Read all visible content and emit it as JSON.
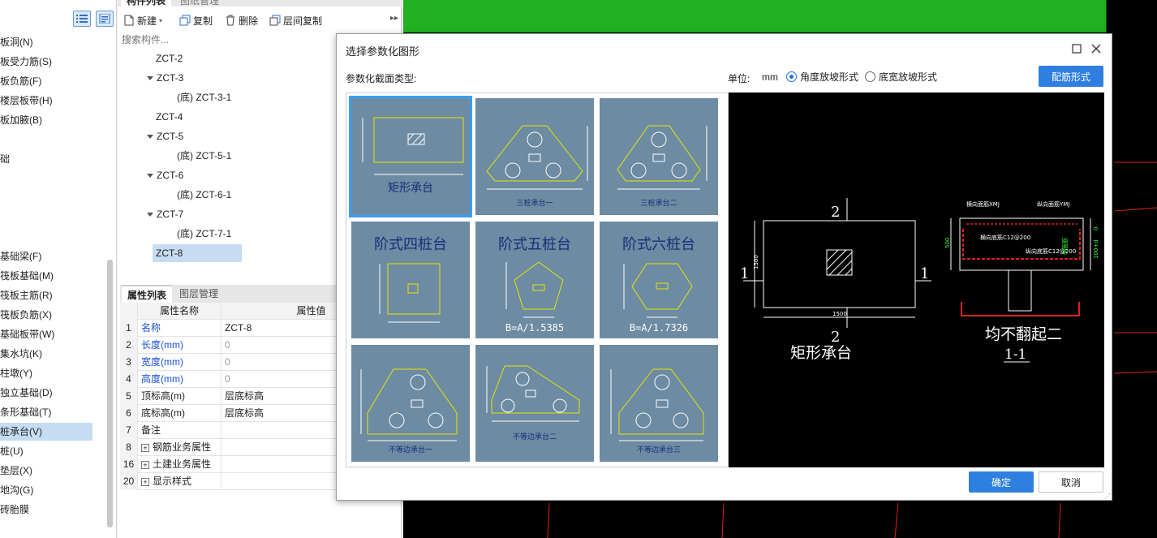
{
  "left_tree": {
    "items": [
      {
        "label": "板洞(N)"
      },
      {
        "label": "板受力筋(S)"
      },
      {
        "label": "板负筋(F)"
      },
      {
        "label": "楼层板带(H)"
      },
      {
        "label": "板加腋(B)"
      },
      {
        "label": "础"
      },
      {
        "label": "基础梁(F)"
      },
      {
        "label": "筏板基础(M)"
      },
      {
        "label": "筏板主筋(R)"
      },
      {
        "label": "筏板负筋(X)"
      },
      {
        "label": "基础板带(W)"
      },
      {
        "label": "集水坑(K)"
      },
      {
        "label": "柱墩(Y)"
      },
      {
        "label": "独立基础(D)"
      },
      {
        "label": "条形基础(T)"
      },
      {
        "label": "桩承台(V)",
        "selected": true
      },
      {
        "label": "桩(U)"
      },
      {
        "label": "垫层(X)"
      },
      {
        "label": "地沟(G)"
      },
      {
        "label": "砖胎膜"
      }
    ]
  },
  "component_panel": {
    "tabs": [
      "构件列表",
      "图纸管理"
    ],
    "toolbar": {
      "new": "新建",
      "copy": "复制",
      "delete": "删除",
      "floor_copy": "层间复制"
    },
    "search_placeholder": "搜索构件...",
    "tree": [
      {
        "label": "ZCT-2",
        "level": 1
      },
      {
        "label": "ZCT-3",
        "level": 1,
        "expanded": true
      },
      {
        "label": "(底) ZCT-3-1",
        "level": 2
      },
      {
        "label": "ZCT-4",
        "level": 1
      },
      {
        "label": "ZCT-5",
        "level": 1,
        "expanded": true
      },
      {
        "label": "(底) ZCT-5-1",
        "level": 2
      },
      {
        "label": "ZCT-6",
        "level": 1,
        "expanded": true
      },
      {
        "label": "(底) ZCT-6-1",
        "level": 2
      },
      {
        "label": "ZCT-7",
        "level": 1,
        "expanded": true
      },
      {
        "label": "(底) ZCT-7-1",
        "level": 2
      },
      {
        "label": "ZCT-8",
        "level": 1,
        "selected": true
      }
    ]
  },
  "properties": {
    "tabs": [
      "属性列表",
      "图层管理"
    ],
    "header": {
      "name": "属性名称",
      "value": "属性值"
    },
    "rows": [
      {
        "num": "1",
        "name": "名称",
        "value": "ZCT-8",
        "blue": true
      },
      {
        "num": "2",
        "name": "长度(mm)",
        "value": "0",
        "blue": true,
        "gray": true
      },
      {
        "num": "3",
        "name": "宽度(mm)",
        "value": "0",
        "blue": true,
        "gray": true
      },
      {
        "num": "4",
        "name": "高度(mm)",
        "value": "0",
        "blue": true,
        "gray": true
      },
      {
        "num": "5",
        "name": "顶标高(m)",
        "value": "层底标高"
      },
      {
        "num": "6",
        "name": "底标高(m)",
        "value": "层底标高"
      },
      {
        "num": "7",
        "name": "备注",
        "value": ""
      },
      {
        "num": "8",
        "name": "钢筋业务属性",
        "value": "",
        "group": true
      },
      {
        "num": "16",
        "name": "土建业务属性",
        "value": "",
        "group": true
      },
      {
        "num": "20",
        "name": "显示样式",
        "value": "",
        "group": true
      }
    ]
  },
  "dialog": {
    "title": "选择参数化图形",
    "type_label": "参数化截面类型:",
    "unit_label": "单位:",
    "unit_value": "mm",
    "radio_angle": "角度放坡形式",
    "radio_width": "底宽放坡形式",
    "rebar_button": "配筋形式",
    "ok": "确定",
    "cancel": "取消",
    "gallery": [
      {
        "label": "矩形承台",
        "selected": true
      },
      {
        "label": "三桩承台一"
      },
      {
        "label": "三桩承台二"
      },
      {
        "label": "阶式四桩台"
      },
      {
        "label": "阶式五桩台",
        "formula": "B=A/1.5385"
      },
      {
        "label": "阶式六桩台",
        "formula": "B=A/1.7326"
      },
      {
        "label": "不等边承台一"
      },
      {
        "label": "不等边承台二"
      },
      {
        "label": "不等边承台三"
      }
    ],
    "preview": {
      "plan_title": "矩形承台",
      "section_title": "均不翻起二",
      "section_label": "1-1",
      "mark_top": "2",
      "mark_bottom": "2",
      "mark_left": "1",
      "mark_right": "1",
      "dim_1500_v": "1500",
      "dim_1500_h": "1500",
      "label_h_rebar": "横向面筋XMJ",
      "label_v_rebar": "纵向面筋YMJ",
      "label_h_bottom": "横向底筋C12@200",
      "label_v_bottom": "纵向底筋C12@200",
      "label_side": "侧面筋",
      "dim_500": "500",
      "dim_0": "0",
      "dim_100d": "100+d"
    }
  },
  "colors": {
    "accent": "#2f7fe0",
    "thumb_bg": "#6d8ba3",
    "shape": "#e6e600"
  }
}
